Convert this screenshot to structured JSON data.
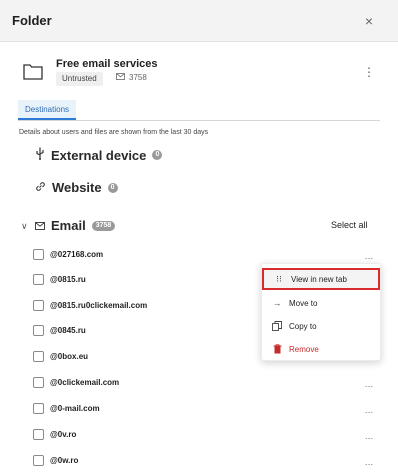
{
  "header": {
    "title": "Folder",
    "close_glyph": "×"
  },
  "item": {
    "name": "Free email services",
    "trust_label": "Untrusted",
    "mail_count": "3758",
    "menu_glyph": "⋮"
  },
  "tabs": [
    {
      "label": "Destinations",
      "active": true
    }
  ],
  "details_note": "Details about users and files are shown from the last 30 days",
  "sections": {
    "external_device": {
      "label": "External device",
      "count": "0"
    },
    "website": {
      "label": "Website",
      "count": "0"
    },
    "email": {
      "label": "Email",
      "count": "3758",
      "select_all": "Select all"
    }
  },
  "emails": [
    {
      "label": "@027168.com"
    },
    {
      "label": "@0815.ru"
    },
    {
      "label": "@0815.ru0clickemail.com"
    },
    {
      "label": "@0845.ru"
    },
    {
      "label": "@0box.eu"
    },
    {
      "label": "@0clickemail.com"
    },
    {
      "label": "@0-mail.com"
    },
    {
      "label": "@0v.ro"
    },
    {
      "label": "@0w.ro"
    }
  ],
  "row_more_glyph": "…",
  "context_menu": {
    "items": [
      {
        "label": "View in new tab",
        "icon": "open-in-new-tab-icon"
      },
      {
        "label": "Move to",
        "icon": "arrow-right-icon"
      },
      {
        "label": "Copy to",
        "icon": "copy-icon"
      },
      {
        "label": "Remove",
        "icon": "trash-icon"
      }
    ]
  },
  "colors": {
    "accent": "#2d7bd6",
    "danger": "#c42b2b",
    "highlight_border": "#d92b2b"
  }
}
